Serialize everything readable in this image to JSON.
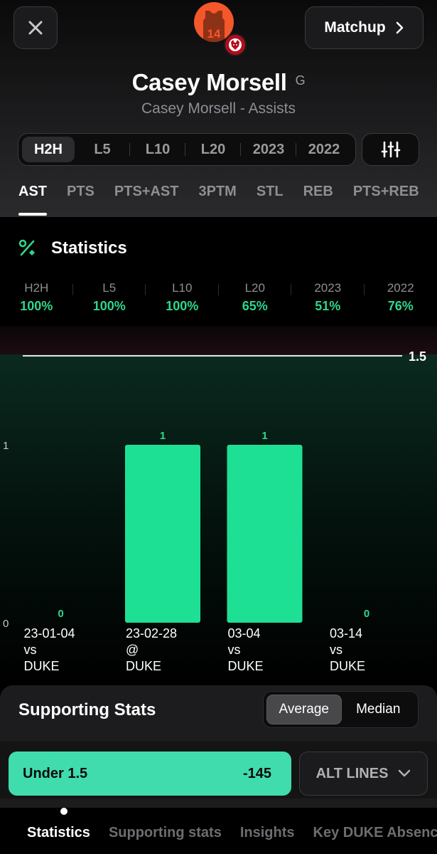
{
  "header": {
    "matchup_label": "Matchup",
    "jersey_number": "14",
    "player_name": "Casey Morsell",
    "position": "G",
    "subtitle": "Casey Morsell - Assists"
  },
  "range_tabs": [
    "H2H",
    "L5",
    "L10",
    "L20",
    "2023",
    "2022"
  ],
  "stat_tabs": [
    "AST",
    "PTS",
    "PTS+AST",
    "3PTM",
    "STL",
    "REB",
    "PTS+REB"
  ],
  "statistics": {
    "title": "Statistics",
    "hit_rates": [
      {
        "label": "H2H",
        "value": "100%"
      },
      {
        "label": "L5",
        "value": "100%"
      },
      {
        "label": "L10",
        "value": "100%"
      },
      {
        "label": "L20",
        "value": "65%"
      },
      {
        "label": "2023",
        "value": "51%"
      },
      {
        "label": "2022",
        "value": "76%"
      }
    ]
  },
  "chart_data": {
    "type": "bar",
    "line_value": 1.5,
    "line_label": "1.5",
    "y_ticks": [
      "0",
      "1"
    ],
    "ylim": [
      0,
      1.5
    ],
    "categories": [
      {
        "date": "23-01-04",
        "venue": "vs",
        "opponent": "DUKE"
      },
      {
        "date": "23-02-28",
        "venue": "@",
        "opponent": "DUKE"
      },
      {
        "date": "03-04",
        "venue": "vs",
        "opponent": "DUKE"
      },
      {
        "date": "03-14",
        "venue": "vs",
        "opponent": "DUKE"
      }
    ],
    "values": [
      0,
      1,
      1,
      0
    ],
    "bar_color": "#1ee095",
    "line_color": "#e5e5ea"
  },
  "supporting": {
    "title": "Supporting Stats",
    "toggle": [
      "Average",
      "Median"
    ],
    "under_label": "Under 1.5",
    "under_odds": "-145",
    "alt_lines_label": "ALT LINES"
  },
  "bottom_tabs": [
    "Statistics",
    "Supporting stats",
    "Insights",
    "Key DUKE Absences"
  ],
  "colors": {
    "accent_green": "#2fd68c",
    "under_button": "#40dcae",
    "avatar": "#f4572a"
  }
}
